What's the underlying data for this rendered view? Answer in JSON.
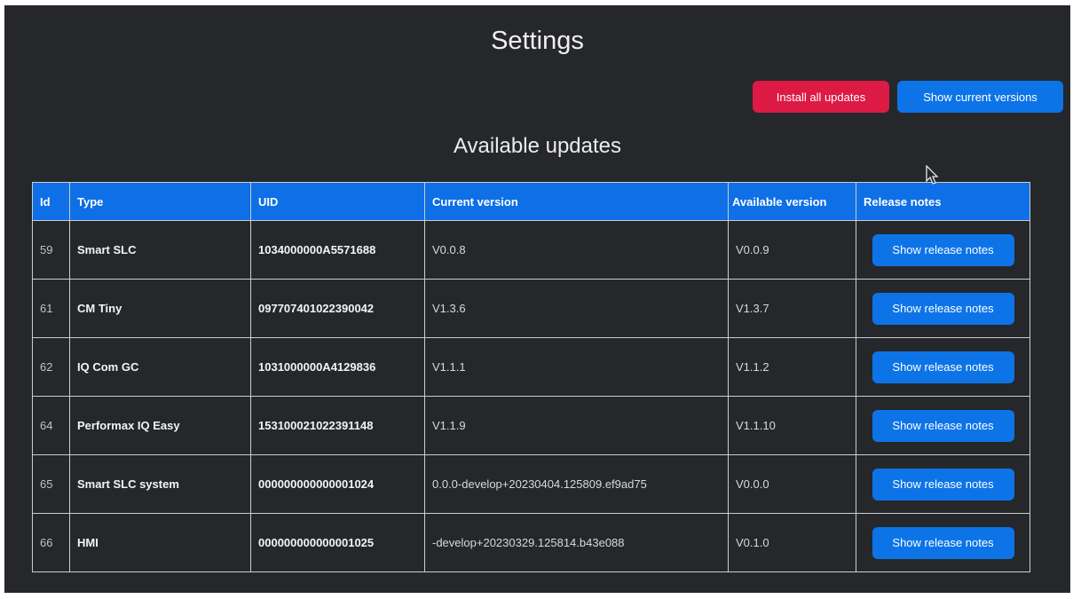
{
  "page": {
    "title": "Settings"
  },
  "actions": {
    "install_all_label": "Install all updates",
    "show_versions_label": "Show current versions"
  },
  "updates": {
    "heading": "Available updates",
    "columns": [
      "Id",
      "Type",
      "UID",
      "Current version",
      "Available version",
      "Release notes"
    ],
    "rows": [
      {
        "id": "59",
        "type": "Smart SLC",
        "uid": "1034000000A5571688",
        "current": "V0.0.8",
        "available": "V0.0.9",
        "notes_label": "Show release notes"
      },
      {
        "id": "61",
        "type": "CM Tiny",
        "uid": "097707401022390042",
        "current": "V1.3.6",
        "available": "V1.3.7",
        "notes_label": "Show release notes"
      },
      {
        "id": "62",
        "type": "IQ Com GC",
        "uid": "1031000000A4129836",
        "current": "V1.1.1",
        "available": "V1.1.2",
        "notes_label": "Show release notes"
      },
      {
        "id": "64",
        "type": "Performax IQ Easy",
        "uid": "153100021022391148",
        "current": "V1.1.9",
        "available": "V1.1.10",
        "notes_label": "Show release notes"
      },
      {
        "id": "65",
        "type": "Smart SLC system",
        "uid": "000000000000001024",
        "current": "0.0.0-develop+20230404.125809.ef9ad75",
        "available": "V0.0.0",
        "notes_label": "Show release notes"
      },
      {
        "id": "66",
        "type": "HMI",
        "uid": "000000000000001025",
        "current": "-develop+20230329.125814.b43e088",
        "available": "V0.1.0",
        "notes_label": "Show release notes"
      }
    ]
  },
  "colors": {
    "background": "#25272b",
    "primary": "#0d74e8",
    "danger": "#dc1a44",
    "table_header": "#0e6fe6"
  },
  "icons": [
    "mouse-pointer-icon"
  ]
}
